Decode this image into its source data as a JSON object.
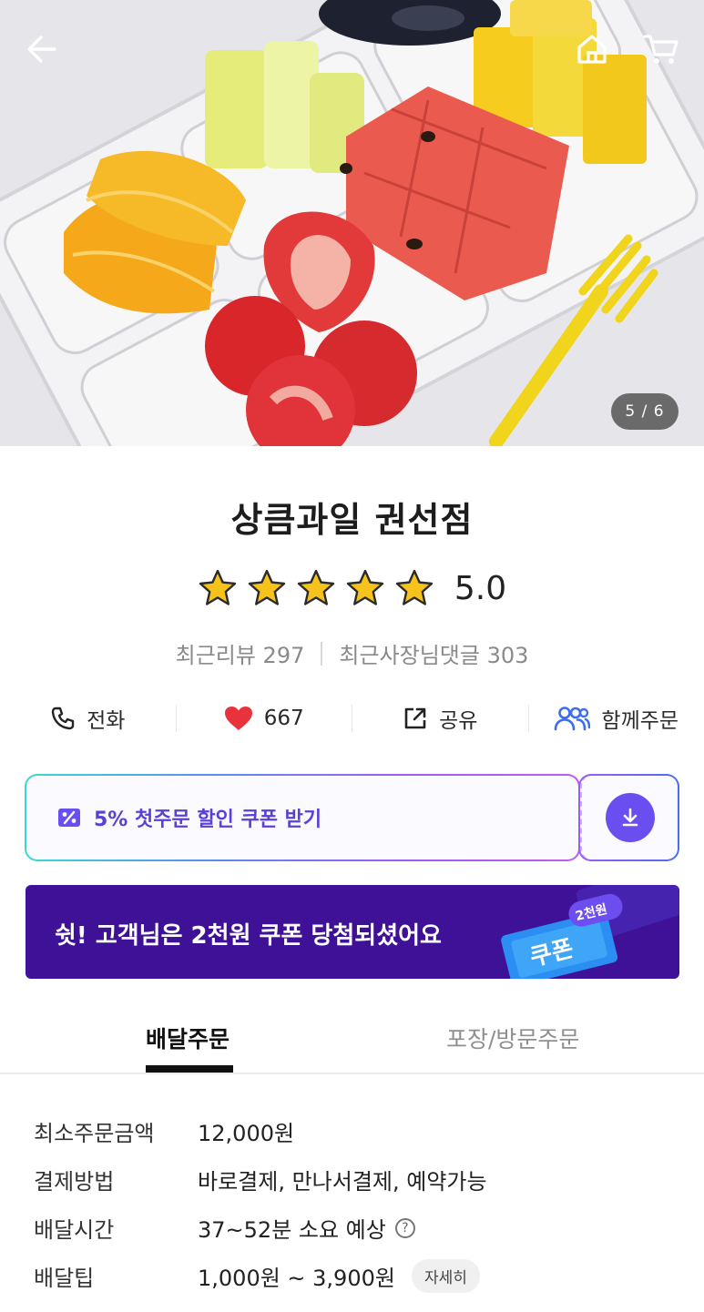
{
  "hero": {
    "counter": "5 / 6",
    "icons": {
      "back": "arrow-left-icon",
      "home": "home-icon",
      "cart": "cart-icon"
    }
  },
  "store": {
    "name": "상큼과일 권선점",
    "rating": "5.0",
    "star_count": 5,
    "recent_reviews": "최근리뷰 297",
    "owner_replies": "최근사장님댓글 303"
  },
  "actions": {
    "call_label": "전화",
    "likes_count": "667",
    "share_label": "공유",
    "group_order_label": "함께주문"
  },
  "coupon": {
    "text": "5% 첫주문 할인 쿠폰 받기",
    "accent_color": "#6a4ef0"
  },
  "promo": {
    "text": "쉿! 고객님은 2천원 쿠폰 당첨되셨어요",
    "ticket_label": "쿠폰",
    "ticket_badge": "2천원",
    "bg_color": "#3f1196"
  },
  "tabs": {
    "delivery": "배달주문",
    "pickup": "포장/방문주문"
  },
  "info": {
    "min_order_label": "최소주문금액",
    "min_order_value": "12,000원",
    "payment_label": "결제방법",
    "payment_value": "바로결제, 만나서결제, 예약가능",
    "delivery_time_label": "배달시간",
    "delivery_time_value": "37~52분 소요 예상",
    "tip_label": "배달팁",
    "tip_value": "1,000원 ~ 3,900원",
    "detail_label": "자세히"
  }
}
